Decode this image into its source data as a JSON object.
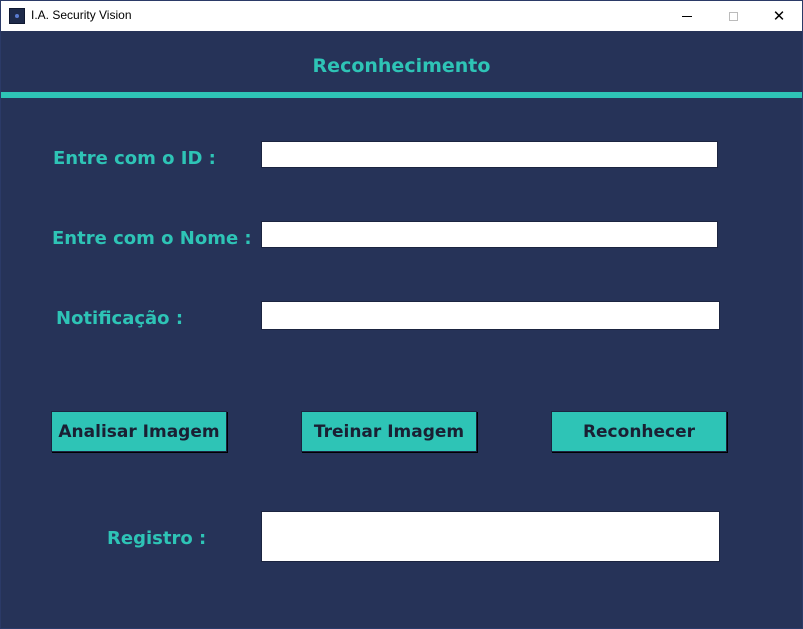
{
  "window": {
    "title": "I.A. Security Vision",
    "close_glyph": "✕"
  },
  "header": {
    "title": "Reconhecimento"
  },
  "form": {
    "id_label": "Entre com o ID :",
    "id_value": "",
    "nome_label": "Entre com o Nome :",
    "nome_value": "",
    "notificacao_label": "Notificação :",
    "notificacao_value": "",
    "registro_label": "Registro :",
    "registro_value": ""
  },
  "buttons": {
    "analisar": "Analisar Imagem",
    "treinar": "Treinar Imagem",
    "reconhecer": "Reconhecer"
  },
  "colors": {
    "background": "#263358",
    "accent": "#2ec4b6",
    "field": "#ffffff"
  },
  "icons": {
    "app": "app-icon",
    "minimize": "minimize-icon",
    "maximize": "maximize-icon",
    "close": "close-icon"
  }
}
